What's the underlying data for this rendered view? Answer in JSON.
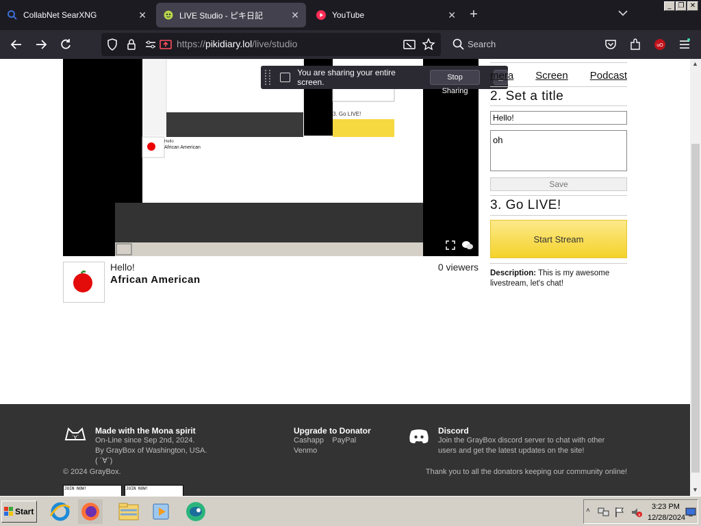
{
  "browser": {
    "tabs": [
      {
        "title": "CollabNet SearXNG",
        "active": false
      },
      {
        "title": "LIVE Studio - ピキ日記",
        "active": true
      },
      {
        "title": "YouTube",
        "active": false
      }
    ],
    "url_prefix": "https://",
    "url_host": "pikidiary.lol",
    "url_path": "/live/studio",
    "search_placeholder": "Search"
  },
  "share_bar": {
    "message": "You are sharing your entire screen.",
    "stop_label": "Stop Sharing",
    "minimize_label": "_"
  },
  "stream": {
    "title": "Hello!",
    "category": "African American",
    "viewers": "0 viewers"
  },
  "sidebar": {
    "sources": [
      "Camera",
      "Screen",
      "Podcast"
    ],
    "sources_visible": [
      "mera",
      "Screen",
      "Podcast"
    ],
    "step2": "2. Set a title",
    "title_value": "Hello!",
    "description_value": "oh",
    "save_label": "Save",
    "step3": "3. Go LIVE!",
    "start_label": "Start Stream",
    "desc_label": "Description:",
    "desc_text": " This is my awesome livestream, let's chat!"
  },
  "footer": {
    "mona_title": "Made with the Mona spirit",
    "mona_line1": "On-Line since Sep 2nd, 2024.",
    "mona_line2": "By GrayBox of Washington, USA.",
    "mona_line3": "(  ´∀`)",
    "copyright": "© 2024 GrayBox.",
    "donor_title": "Upgrade to Donator",
    "donor_cashapp": "Cashapp",
    "donor_paypal": "PayPal",
    "donor_venmo": "Venmo",
    "discord_title": "Discord",
    "discord_text": "Join the GrayBox discord server to chat with other users and get the latest updates on the site!",
    "thanks": "Thank you to all the donators keeping our community online!",
    "banner1": "JOIN NOW!",
    "banner2": "JOIN NOW!"
  },
  "taskbar": {
    "start_label": "Start",
    "time": "3:23 PM",
    "date": "12/28/2024"
  },
  "colors": {
    "start_stream_yellow": "#f4d22a",
    "footer_bg": "#333333",
    "browser_dark": "#2b2a33"
  }
}
